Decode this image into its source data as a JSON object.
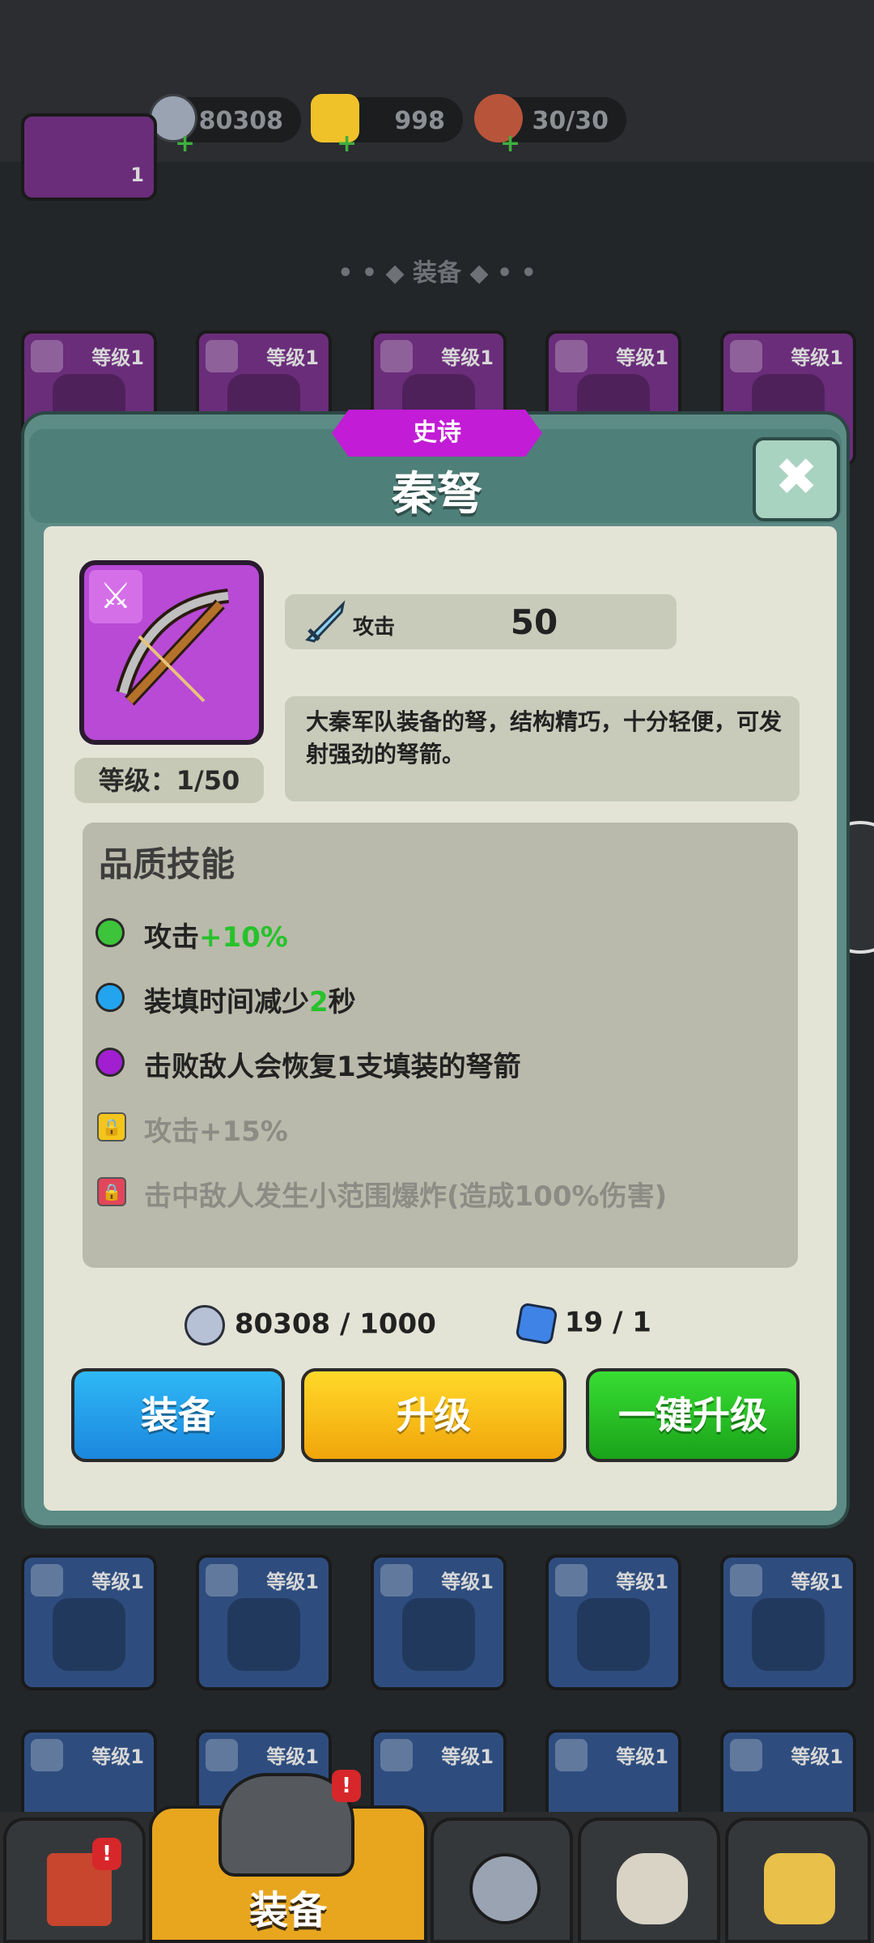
{
  "resources": [
    {
      "name": "silver-coin",
      "value": "80308"
    },
    {
      "name": "gold-ingot",
      "value": "998"
    },
    {
      "name": "meat",
      "value": "30/30"
    }
  ],
  "background": {
    "section_title": "装备",
    "level_label": "等级1",
    "top_item_count": "1"
  },
  "modal": {
    "rarity": "史诗",
    "item_name": "秦弩",
    "level": "等级：1/50",
    "stat": {
      "label": "攻击",
      "value": "50"
    },
    "description": "大秦军队装备的弩，结构精巧，十分轻便，可发射强劲的弩箭。",
    "skills_title": "品质技能",
    "skills": [
      {
        "prefix": "攻击",
        "highlight": "+10%",
        "suffix": "",
        "color": "#3dc43a",
        "locked": false
      },
      {
        "prefix": "装填时间减少",
        "highlight": "2",
        "suffix": "秒",
        "color": "#23a4ef",
        "locked": false
      },
      {
        "prefix": "击败敌人会恢复1支填装的弩箭",
        "highlight": "",
        "suffix": "",
        "color": "#a11ed1",
        "locked": false
      },
      {
        "prefix": "攻击+15%",
        "highlight": "",
        "suffix": "",
        "color": "#f4c51c",
        "locked": true
      },
      {
        "prefix": "击中敌人发生小范围爆炸(造成100%伤害)",
        "highlight": "",
        "suffix": "",
        "color": "#e2465a",
        "locked": true
      }
    ],
    "cost": {
      "coins": "80308 / 1000",
      "shards": "19 / 1"
    },
    "buttons": {
      "equip": "装备",
      "upgrade": "升级",
      "one_key_upgrade": "一键升级"
    },
    "close_icon": "✖"
  },
  "bottom_nav": {
    "active_label": "装备",
    "badge": "!"
  },
  "colors": {
    "epic": "#c21cd6",
    "equip_btn": "#1b9ee8",
    "upgrade_btn": "#f8c216",
    "onekey_btn": "#27c22b"
  }
}
